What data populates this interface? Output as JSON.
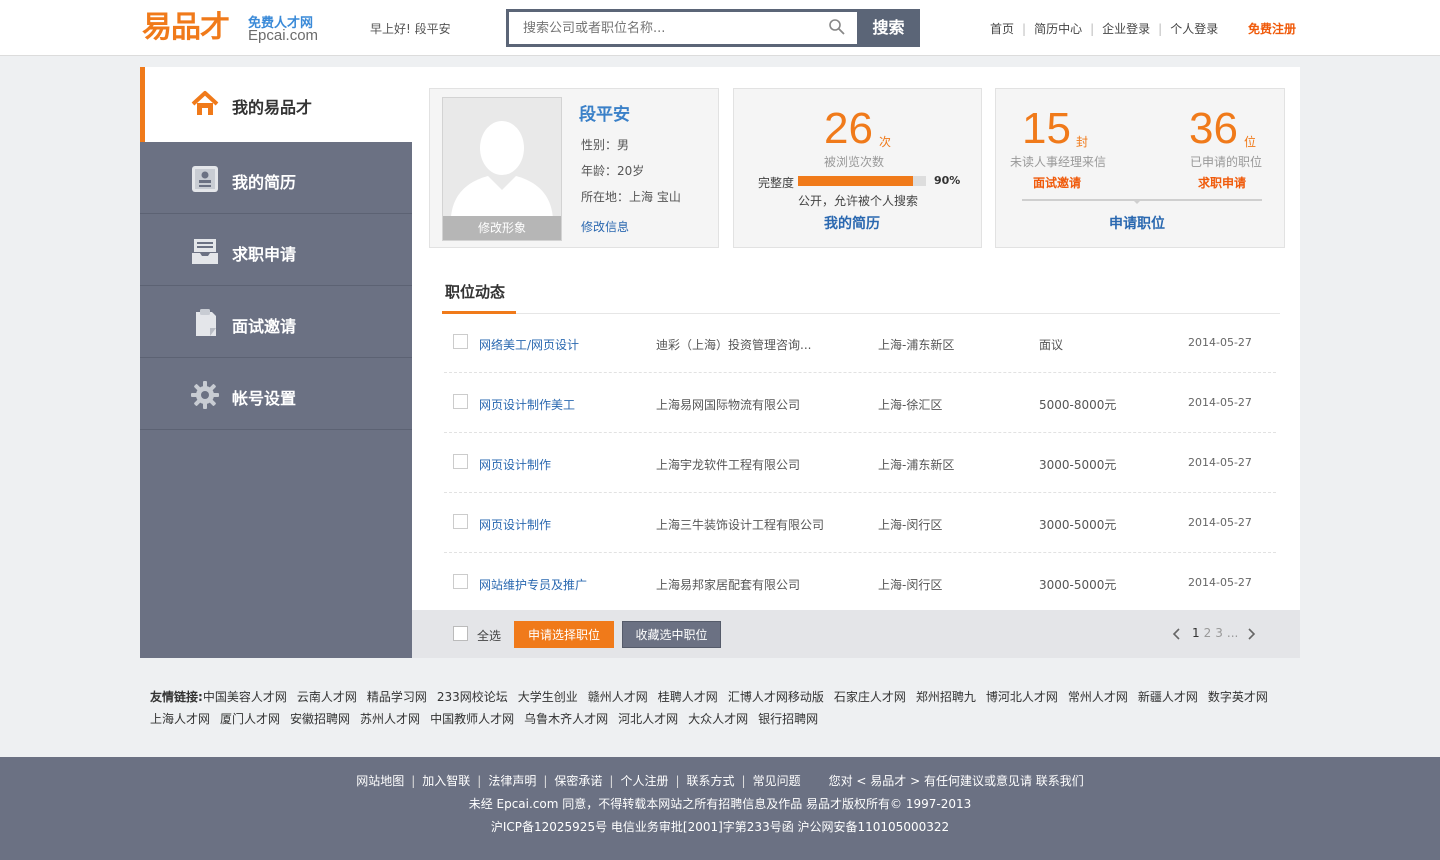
{
  "header": {
    "logo_mark": "易品才",
    "logo_tagline": "免费人才网",
    "logo_domain": "Epcai.com",
    "greeting": "早上好! 段平安",
    "search_placeholder": "搜索公司或者职位名称...",
    "search_button": "搜索",
    "nav": [
      "首页",
      "简历中心",
      "企业登录",
      "个人登录"
    ],
    "register": "免费注册",
    "accent_color": "#f07a1a"
  },
  "sidebar": {
    "items": [
      {
        "label": "我的易品才",
        "icon": "home-icon",
        "active": true
      },
      {
        "label": "我的简历",
        "icon": "resume-icon"
      },
      {
        "label": "求职申请",
        "icon": "inbox-icon"
      },
      {
        "label": "面试邀请",
        "icon": "clipboard-icon"
      },
      {
        "label": "帐号设置",
        "icon": "gear-icon"
      }
    ]
  },
  "profile": {
    "name": "段平安",
    "gender": "性别：男",
    "age": "年龄：20岁",
    "location": "所在地：上海 宝山",
    "edit_avatar": "修改形象",
    "edit_info": "修改信息"
  },
  "resume": {
    "views": "26",
    "views_unit": "次",
    "views_label": "被浏览次数",
    "complete_label": "完整度",
    "complete_percent": 90,
    "complete_text": "90%",
    "privacy": "公开，允许被个人搜索",
    "title": "我的简历"
  },
  "apply": {
    "unread": "15",
    "unread_unit": "封",
    "unread_label": "未读人事经理来信",
    "unread_link": "面试邀请",
    "applied": "36",
    "applied_unit": "位",
    "applied_label": "已申请的职位",
    "applied_link": "求职申请",
    "title": "申请职位"
  },
  "tab": {
    "label": "职位动态"
  },
  "jobs": [
    {
      "title": "网络美工/网页设计",
      "company": "迪彩（上海）投资管理咨询...",
      "location": "上海-浦东新区",
      "salary": "面议",
      "date": "2014-05-27"
    },
    {
      "title": "网页设计制作美工",
      "company": "上海易网国际物流有限公司",
      "location": "上海-徐汇区",
      "salary": "5000-8000元",
      "date": "2014-05-27"
    },
    {
      "title": "网页设计制作",
      "company": "上海宇龙软件工程有限公司",
      "location": "上海-浦东新区",
      "salary": "3000-5000元",
      "date": "2014-05-27"
    },
    {
      "title": "网页设计制作",
      "company": "上海三牛装饰设计工程有限公司",
      "location": "上海-闵行区",
      "salary": "3000-5000元",
      "date": "2014-05-27"
    },
    {
      "title": "网站维护专员及推广",
      "company": "上海易邦家居配套有限公司",
      "location": "上海-闵行区",
      "salary": "3000-5000元",
      "date": "2014-05-27"
    }
  ],
  "actions": {
    "select_all": "全选",
    "apply_selected": "申请选择职位",
    "favorite_selected": "收藏选中职位"
  },
  "pager": {
    "pages": [
      "1",
      "2",
      "3"
    ],
    "ellipsis": "...",
    "current": "1"
  },
  "links": {
    "title": "友情链接:",
    "items": [
      "中国美容人才网",
      "云南人才网",
      "精品学习网",
      "233网校论坛",
      "大学生创业",
      "赣州人才网",
      "桂聘人才网",
      "汇博人才网移动版",
      "石家庄人才网",
      "郑州招聘九",
      "博河北人才网",
      "常州人才网",
      "新疆人才网",
      "数字英才网",
      "上海人才网",
      "厦门人才网",
      "安徽招聘网",
      "苏州人才网",
      "中国教师人才网",
      "乌鲁木齐人才网",
      "河北人才网",
      "大众人才网",
      "银行招聘网"
    ]
  },
  "footer": {
    "nav": [
      "网站地图",
      "加入智联",
      "法律声明",
      "保密承诺",
      "个人注册",
      "联系方式",
      "常见问题"
    ],
    "feedback": "您对 < 易品才 > 有任何建议或意见请 联系我们",
    "copyright": "未经 Epcai.com 同意，不得转载本网站之所有招聘信息及作品 易品才版权所有© 1997-2013",
    "icp": "沪ICP备12025925号 电信业务审批[2001]字第233号函 沪公网安备110105000322"
  }
}
